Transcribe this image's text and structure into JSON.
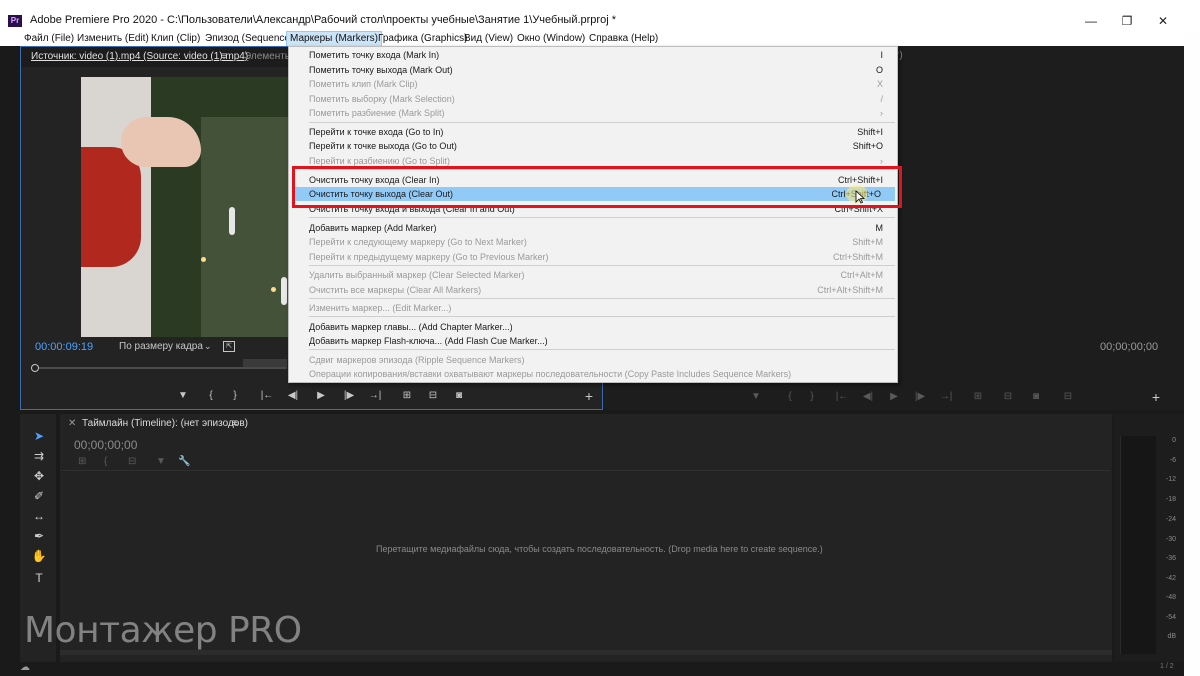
{
  "window": {
    "app_icon": "Pr",
    "title": "Adobe Premiere Pro 2020 - C:\\Пользователи\\Александр\\Рабочий стол\\проекты учебные\\Занятие 1\\Учебный.prproj *",
    "minimize_icon": "—",
    "maximize_icon": "❐",
    "close_icon": "✕"
  },
  "menubar": [
    {
      "label": "Файл (File)"
    },
    {
      "label": "Изменить (Edit)"
    },
    {
      "label": "Клип (Clip)"
    },
    {
      "label": "Эпизод (Sequence)"
    },
    {
      "label": "Маркеры (Markers)"
    },
    {
      "label": "Графика (Graphics)"
    },
    {
      "label": "Вид (View)"
    },
    {
      "label": "Окно (Window)"
    },
    {
      "label": "Справка (Help)"
    }
  ],
  "markers_menu": {
    "items": [
      {
        "label": "Пометить точку входа (Mark In)",
        "shortcut": "I",
        "enabled": true
      },
      {
        "label": "Пометить точку выхода (Mark Out)",
        "shortcut": "O",
        "enabled": true
      },
      {
        "label": "Пометить клип (Mark Clip)",
        "shortcut": "X",
        "enabled": false
      },
      {
        "label": "Пометить выборку (Mark Selection)",
        "shortcut": "/",
        "enabled": false
      },
      {
        "label": "Пометить разбиение (Mark Split)",
        "shortcut": "›",
        "enabled": false
      },
      {
        "label": "Перейти к точке входа (Go to In)",
        "shortcut": "Shift+I",
        "enabled": true
      },
      {
        "label": "Перейти к точке выхода (Go to Out)",
        "shortcut": "Shift+O",
        "enabled": true
      },
      {
        "label": "Перейти к разбиению (Go to Split)",
        "shortcut": "›",
        "enabled": false
      },
      {
        "label": "Очистить точку входа (Clear In)",
        "shortcut": "Ctrl+Shift+I",
        "enabled": true
      },
      {
        "label": "Очистить точку выхода (Clear Out)",
        "shortcut": "Ctrl+Shift+O",
        "enabled": true,
        "highlighted": true
      },
      {
        "label": "Очистить точку входа и выхода (Clear In and Out)",
        "shortcut": "Ctrl+Shift+X",
        "enabled": true
      },
      {
        "label": "Добавить маркер (Add Marker)",
        "shortcut": "M",
        "enabled": true
      },
      {
        "label": "Перейти к следующему маркеру (Go to Next Marker)",
        "shortcut": "Shift+M",
        "enabled": false
      },
      {
        "label": "Перейти к предыдущему маркеру (Go to Previous Marker)",
        "shortcut": "Ctrl+Shift+M",
        "enabled": false
      },
      {
        "label": "Удалить выбранный маркер (Clear Selected Marker)",
        "shortcut": "Ctrl+Alt+M",
        "enabled": false
      },
      {
        "label": "Очистить все маркеры (Clear All Markers)",
        "shortcut": "Ctrl+Alt+Shift+M",
        "enabled": false
      },
      {
        "label": "Изменить маркер... (Edit Marker...)",
        "shortcut": "",
        "enabled": false
      },
      {
        "label": "Добавить маркер главы... (Add Chapter Marker...)",
        "shortcut": "",
        "enabled": true
      },
      {
        "label": "Добавить маркер Flash-ключа... (Add Flash Cue Marker...)",
        "shortcut": "",
        "enabled": true
      },
      {
        "label": "Сдвиг маркеров эпизода (Ripple Sequence Markers)",
        "shortcut": "",
        "enabled": false
      },
      {
        "label": "Операции копирования/вставки охватывают маркеры последовательности (Copy Paste Includes Sequence Markers)",
        "shortcut": "",
        "enabled": false
      }
    ]
  },
  "source_monitor": {
    "tab_label": "Источник: video (1).mp4 (Source: video (1).mp4)",
    "tab_menu_icon": "≡",
    "next_tab_label": "Элементы",
    "timecode": "00:00:09:19",
    "fit_label": "По размеру кадра",
    "fit_arrow": "⌄",
    "export_icon_glyph": "⇱",
    "transport": [
      {
        "name": "add-marker-icon",
        "glyph": "▼"
      },
      {
        "name": "mark-in-icon",
        "glyph": "{"
      },
      {
        "name": "mark-out-icon",
        "glyph": "}"
      },
      {
        "name": "go-to-in-icon",
        "glyph": "|←"
      },
      {
        "name": "step-back-icon",
        "glyph": "◀|"
      },
      {
        "name": "play-icon",
        "glyph": "▶"
      },
      {
        "name": "step-forward-icon",
        "glyph": "|▶"
      },
      {
        "name": "go-to-out-icon",
        "glyph": "→|"
      },
      {
        "name": "insert-icon",
        "glyph": "⊞"
      },
      {
        "name": "overwrite-icon",
        "glyph": "⊟"
      },
      {
        "name": "export-frame-icon",
        "glyph": "◙"
      },
      {
        "name": "add-button-icon",
        "glyph": "+"
      }
    ]
  },
  "program_monitor": {
    "tab_tail": "r)",
    "timecode": "00;00;00;00",
    "add_glyph": "+"
  },
  "timeline": {
    "close_glyph": "✕",
    "tab_label": "Таймлайн (Timeline): (нет эпизодов)",
    "menu_icon": "≡",
    "timecode": "00;00;00;00",
    "wrench_glyph": "🔧",
    "drop_message": "Перетащите медиафайлы сюда, чтобы создать последовательность. (Drop media here to create sequence.)"
  },
  "tools": [
    {
      "name": "selection-tool-icon",
      "glyph": "➤"
    },
    {
      "name": "track-select-tool-icon",
      "glyph": "⇉"
    },
    {
      "name": "ripple-edit-tool-icon",
      "glyph": "✥"
    },
    {
      "name": "razor-tool-icon",
      "glyph": "✐"
    },
    {
      "name": "slip-tool-icon",
      "glyph": "↔"
    },
    {
      "name": "pen-tool-icon",
      "glyph": "✒"
    },
    {
      "name": "hand-tool-icon",
      "glyph": "✋"
    },
    {
      "name": "type-tool-icon",
      "glyph": "T"
    }
  ],
  "meter_labels": [
    "0",
    "-6",
    "-12",
    "-18",
    "-24",
    "-30",
    "-36",
    "-42",
    "-48",
    "-54",
    "dB"
  ],
  "status": {
    "cloud_icon": "☁",
    "page_indicator": "1 / 2"
  },
  "watermark": "Монтажер PRO",
  "colors": {
    "highlight_box": "#e1141d",
    "menu_highlight": "#91c9f7",
    "timecode_blue": "#4da2ff"
  }
}
